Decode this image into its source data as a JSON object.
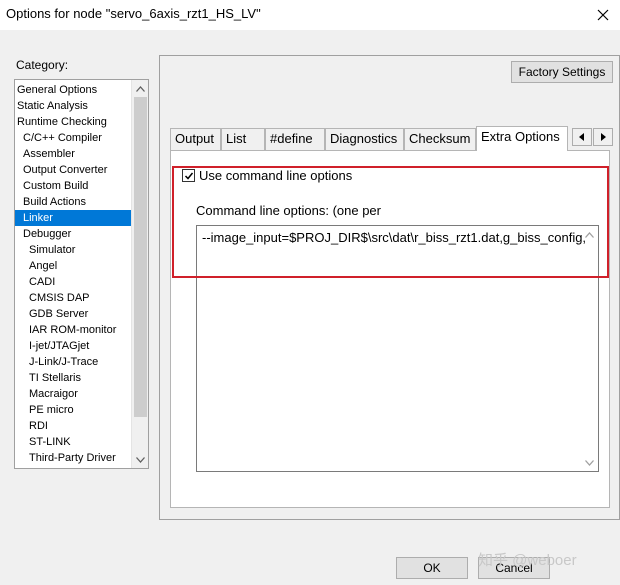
{
  "window": {
    "title": "Options for node \"servo_6axis_rzt1_HS_LV\"",
    "close_icon": "close-icon"
  },
  "category": {
    "label": "Category:",
    "items": [
      {
        "label": "General Options",
        "level": 0,
        "selected": false
      },
      {
        "label": "Static Analysis",
        "level": 0,
        "selected": false
      },
      {
        "label": "Runtime Checking",
        "level": 0,
        "selected": false
      },
      {
        "label": "C/C++ Compiler",
        "level": 1,
        "selected": false
      },
      {
        "label": "Assembler",
        "level": 1,
        "selected": false
      },
      {
        "label": "Output Converter",
        "level": 1,
        "selected": false
      },
      {
        "label": "Custom Build",
        "level": 1,
        "selected": false
      },
      {
        "label": "Build Actions",
        "level": 1,
        "selected": false
      },
      {
        "label": "Linker",
        "level": 1,
        "selected": true
      },
      {
        "label": "Debugger",
        "level": 1,
        "selected": false
      },
      {
        "label": "Simulator",
        "level": 2,
        "selected": false
      },
      {
        "label": "Angel",
        "level": 2,
        "selected": false
      },
      {
        "label": "CADI",
        "level": 2,
        "selected": false
      },
      {
        "label": "CMSIS DAP",
        "level": 2,
        "selected": false
      },
      {
        "label": "GDB Server",
        "level": 2,
        "selected": false
      },
      {
        "label": "IAR ROM-monitor",
        "level": 2,
        "selected": false
      },
      {
        "label": "I-jet/JTAGjet",
        "level": 2,
        "selected": false
      },
      {
        "label": "J-Link/J-Trace",
        "level": 2,
        "selected": false
      },
      {
        "label": "TI Stellaris",
        "level": 2,
        "selected": false
      },
      {
        "label": "Macraigor",
        "level": 2,
        "selected": false
      },
      {
        "label": "PE micro",
        "level": 2,
        "selected": false
      },
      {
        "label": "RDI",
        "level": 2,
        "selected": false
      },
      {
        "label": "ST-LINK",
        "level": 2,
        "selected": false
      },
      {
        "label": "Third-Party Driver",
        "level": 2,
        "selected": false
      }
    ]
  },
  "factory_settings_label": "Factory Settings",
  "tabs": [
    {
      "label": "Output",
      "active": false
    },
    {
      "label": "List",
      "active": false
    },
    {
      "label": "#define",
      "active": false
    },
    {
      "label": "Diagnostics",
      "active": false
    },
    {
      "label": "Checksum",
      "active": false
    },
    {
      "label": "Extra Options",
      "active": true
    }
  ],
  "extra_options": {
    "use_cmd_label": "Use command line options",
    "use_cmd_checked": true,
    "cmd_label": "Command line options:  (one per",
    "cmd_value": "--image_input=$PROJ_DIR$\\src\\dat\\r_biss_rzt1.dat,g_biss_config,"
  },
  "buttons": {
    "ok": "OK",
    "cancel": "Cancel"
  },
  "watermark": "知乎 @weboer",
  "colors": {
    "selection": "#0078d7",
    "highlight_box": "#d0202a"
  }
}
